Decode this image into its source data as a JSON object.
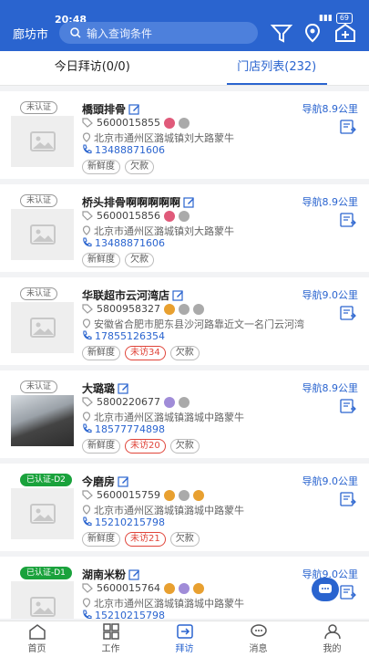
{
  "status_bar": {
    "time": "20:48",
    "battery": "69"
  },
  "header": {
    "city": "廊坊市",
    "search_placeholder": "输入查询条件"
  },
  "tabs": [
    {
      "label": "今日拜访(0/0)",
      "active": false
    },
    {
      "label": "门店列表(232)",
      "active": true
    }
  ],
  "stores": [
    {
      "cert": "未认证",
      "certified": false,
      "name": "橋頭排骨",
      "code": "5600015855",
      "badges": [
        "red",
        "gray"
      ],
      "address": "北京市通州区潞城镇刘大路蒙牛",
      "phone": "13488871606",
      "tags": [
        {
          "text": "新鲜度",
          "red": false
        },
        {
          "text": "欠款",
          "red": false
        }
      ],
      "nav": "导航8.9公里",
      "photo": false
    },
    {
      "cert": "未认证",
      "certified": false,
      "name": "桥头排骨啊啊啊啊啊",
      "code": "5600015856",
      "badges": [
        "red",
        "gray"
      ],
      "address": "北京市通州区潞城镇刘大路蒙牛",
      "phone": "13488871606",
      "tags": [
        {
          "text": "新鲜度",
          "red": false
        },
        {
          "text": "欠款",
          "red": false
        }
      ],
      "nav": "导航8.9公里",
      "photo": false
    },
    {
      "cert": "未认证",
      "certified": false,
      "name": "华联超市云河湾店",
      "code": "5800958327",
      "badges": [
        "orange",
        "gray",
        "gray"
      ],
      "address": "安徽省合肥市肥东县沙河路靠近文一名门云河湾",
      "phone": "17855126354",
      "tags": [
        {
          "text": "新鲜度",
          "red": false
        },
        {
          "text": "未访34",
          "red": true
        },
        {
          "text": "欠款",
          "red": false
        }
      ],
      "nav": "导航9.0公里",
      "photo": false
    },
    {
      "cert": "未认证",
      "certified": false,
      "name": "大璐璐",
      "code": "5800220677",
      "badges": [
        "purple",
        "gray"
      ],
      "address": "北京市通州区潞城镇潞城中路蒙牛",
      "phone": "18577774898",
      "tags": [
        {
          "text": "新鲜度",
          "red": false
        },
        {
          "text": "未访20",
          "red": true
        },
        {
          "text": "欠款",
          "red": false
        }
      ],
      "nav": "导航8.9公里",
      "photo": true
    },
    {
      "cert": "已认证-D2",
      "certified": true,
      "name": "今磨房",
      "code": "5600015759",
      "badges": [
        "orange",
        "gray",
        "orange"
      ],
      "address": "北京市通州区潞城镇潞城中路蒙牛",
      "phone": "15210215798",
      "tags": [
        {
          "text": "新鲜度",
          "red": false
        },
        {
          "text": "未访21",
          "red": true
        },
        {
          "text": "欠款",
          "red": false
        }
      ],
      "nav": "导航9.0公里",
      "photo": false
    },
    {
      "cert": "已认证-D1",
      "certified": true,
      "name": "湖南米粉",
      "code": "5600015764",
      "badges": [
        "orange",
        "purple",
        "orange"
      ],
      "address": "北京市通州区潞城镇潞城中路蒙牛",
      "phone": "15210215798",
      "tags": [],
      "nav": "导航9.0公里",
      "photo": false
    }
  ],
  "bottom_nav": [
    {
      "label": "首页",
      "icon": "home-icon",
      "active": false
    },
    {
      "label": "工作",
      "icon": "grid-icon",
      "active": false
    },
    {
      "label": "拜访",
      "icon": "visit-icon",
      "active": true
    },
    {
      "label": "消息",
      "icon": "message-icon",
      "active": false
    },
    {
      "label": "我的",
      "icon": "user-icon",
      "active": false
    }
  ],
  "colors": {
    "primary": "#2a64cf",
    "certified": "#1aa23c",
    "warning": "#e0453a"
  }
}
